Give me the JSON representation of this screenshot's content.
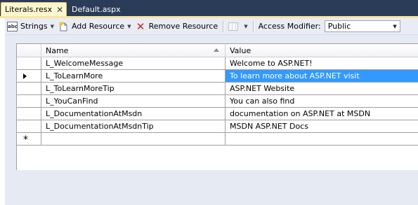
{
  "tabs": [
    {
      "label": "Literals.resx",
      "active": true
    },
    {
      "label": "Default.aspx",
      "active": false
    }
  ],
  "toolbar": {
    "strings_label": "Strings",
    "add_resource_label": "Add Resource",
    "remove_resource_label": "Remove Resource",
    "access_modifier_label": "Access Modifier:",
    "access_modifier_value": "Public"
  },
  "grid": {
    "columns": [
      "Name",
      "Value"
    ],
    "rows": [
      {
        "name": "L_WelcomeMessage",
        "value": "Welcome to ASP.NET!"
      },
      {
        "name": "L_ToLearnMore",
        "value": "To learn more about ASP.NET visit"
      },
      {
        "name": "L_ToLearnMoreTip",
        "value": "ASP.NET Website"
      },
      {
        "name": "L_YouCanFind",
        "value": "You can also find"
      },
      {
        "name": "L_DocumentationAtMsdn",
        "value": "documentation on ASP.NET at MSDN"
      },
      {
        "name": "L_DocumentationAtMsdnTip",
        "value": "MSDN ASP.NET Docs"
      }
    ],
    "selected_row": 1,
    "new_row_marker": "*"
  },
  "colors": {
    "tab_active_bg": "#fff7d0",
    "selection": "#3399ff",
    "remove_icon": "#d21f1f",
    "frame": "#2b3c59"
  }
}
